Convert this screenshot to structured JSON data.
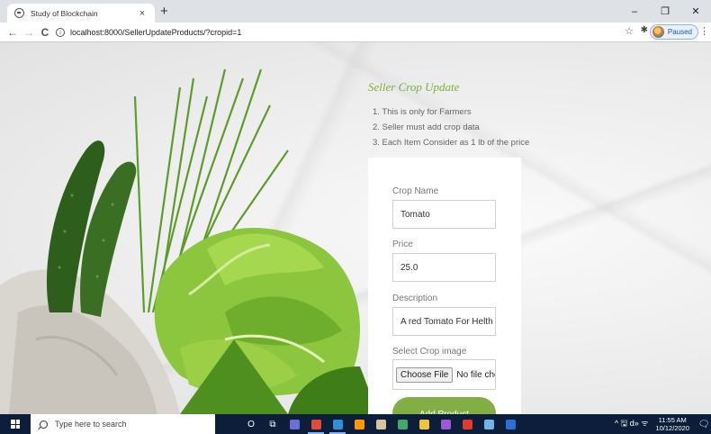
{
  "browser": {
    "tab_title": "Study of Blockchain",
    "tab_close": "×",
    "new_tab": "+",
    "window_controls": {
      "minimize": "–",
      "maximize": "❐",
      "close": "✕"
    },
    "nav": {
      "back": "←",
      "forward": "→",
      "reload": "C"
    },
    "info_icon": "i",
    "url": "localhost:8000/SellerUpdateProducts/?cropid=1",
    "star_icon": "☆",
    "extension_icon": "✱",
    "profile_status": "Paused",
    "menu_icon": "⋮"
  },
  "page": {
    "heading": "Seller Crop Update",
    "rules": [
      "1. This is only for Farmers",
      "2. Seller must add crop data",
      "3. Each Item Consider as 1 lb of the price"
    ],
    "form": {
      "crop_name_label": "Crop Name",
      "crop_name_value": "Tomato",
      "price_label": "Price",
      "price_value": "25.0",
      "description_label": "Description",
      "description_value": "A red Tomato For Helth",
      "image_label": "Select Crop image",
      "choose_file_label": "Choose File",
      "file_status": "No file chosen",
      "submit_label": "Add Product"
    }
  },
  "taskbar": {
    "search_placeholder": "Type here to search",
    "tray_icons": "^ 🖫 d» ᯤ",
    "time": "11:55 AM",
    "date": "10/12/2020",
    "notification_icon": "🗨",
    "apps": [
      {
        "name": "cortana-icon",
        "glyph": "O",
        "color": ""
      },
      {
        "name": "task-view-icon",
        "glyph": "⧉",
        "color": ""
      },
      {
        "name": "app-icon-1",
        "glyph": "",
        "color": "#6d6dd6"
      },
      {
        "name": "chrome-icon",
        "glyph": "",
        "color": "#e04a3a"
      },
      {
        "name": "vscode-icon",
        "glyph": "",
        "color": "#2f8fd6"
      },
      {
        "name": "app-icon-2",
        "glyph": "",
        "color": "#ff9900"
      },
      {
        "name": "app-icon-3",
        "glyph": "",
        "color": "#d8c4a0"
      },
      {
        "name": "app-icon-4",
        "glyph": "",
        "color": "#3fa86b"
      },
      {
        "name": "file-explorer-icon",
        "glyph": "",
        "color": "#f0c33c"
      },
      {
        "name": "app-icon-5",
        "glyph": "",
        "color": "#9b59d6"
      },
      {
        "name": "pdf-icon",
        "glyph": "",
        "color": "#e23a2e"
      },
      {
        "name": "app-icon-6",
        "glyph": "",
        "color": "#6fb3e8"
      },
      {
        "name": "app-icon-7",
        "glyph": "",
        "color": "#2b6fd6"
      }
    ]
  },
  "colors": {
    "accent_green": "#82ae46",
    "heading_green": "#7ab03c",
    "taskbar_bg": "#0c1e3a"
  }
}
